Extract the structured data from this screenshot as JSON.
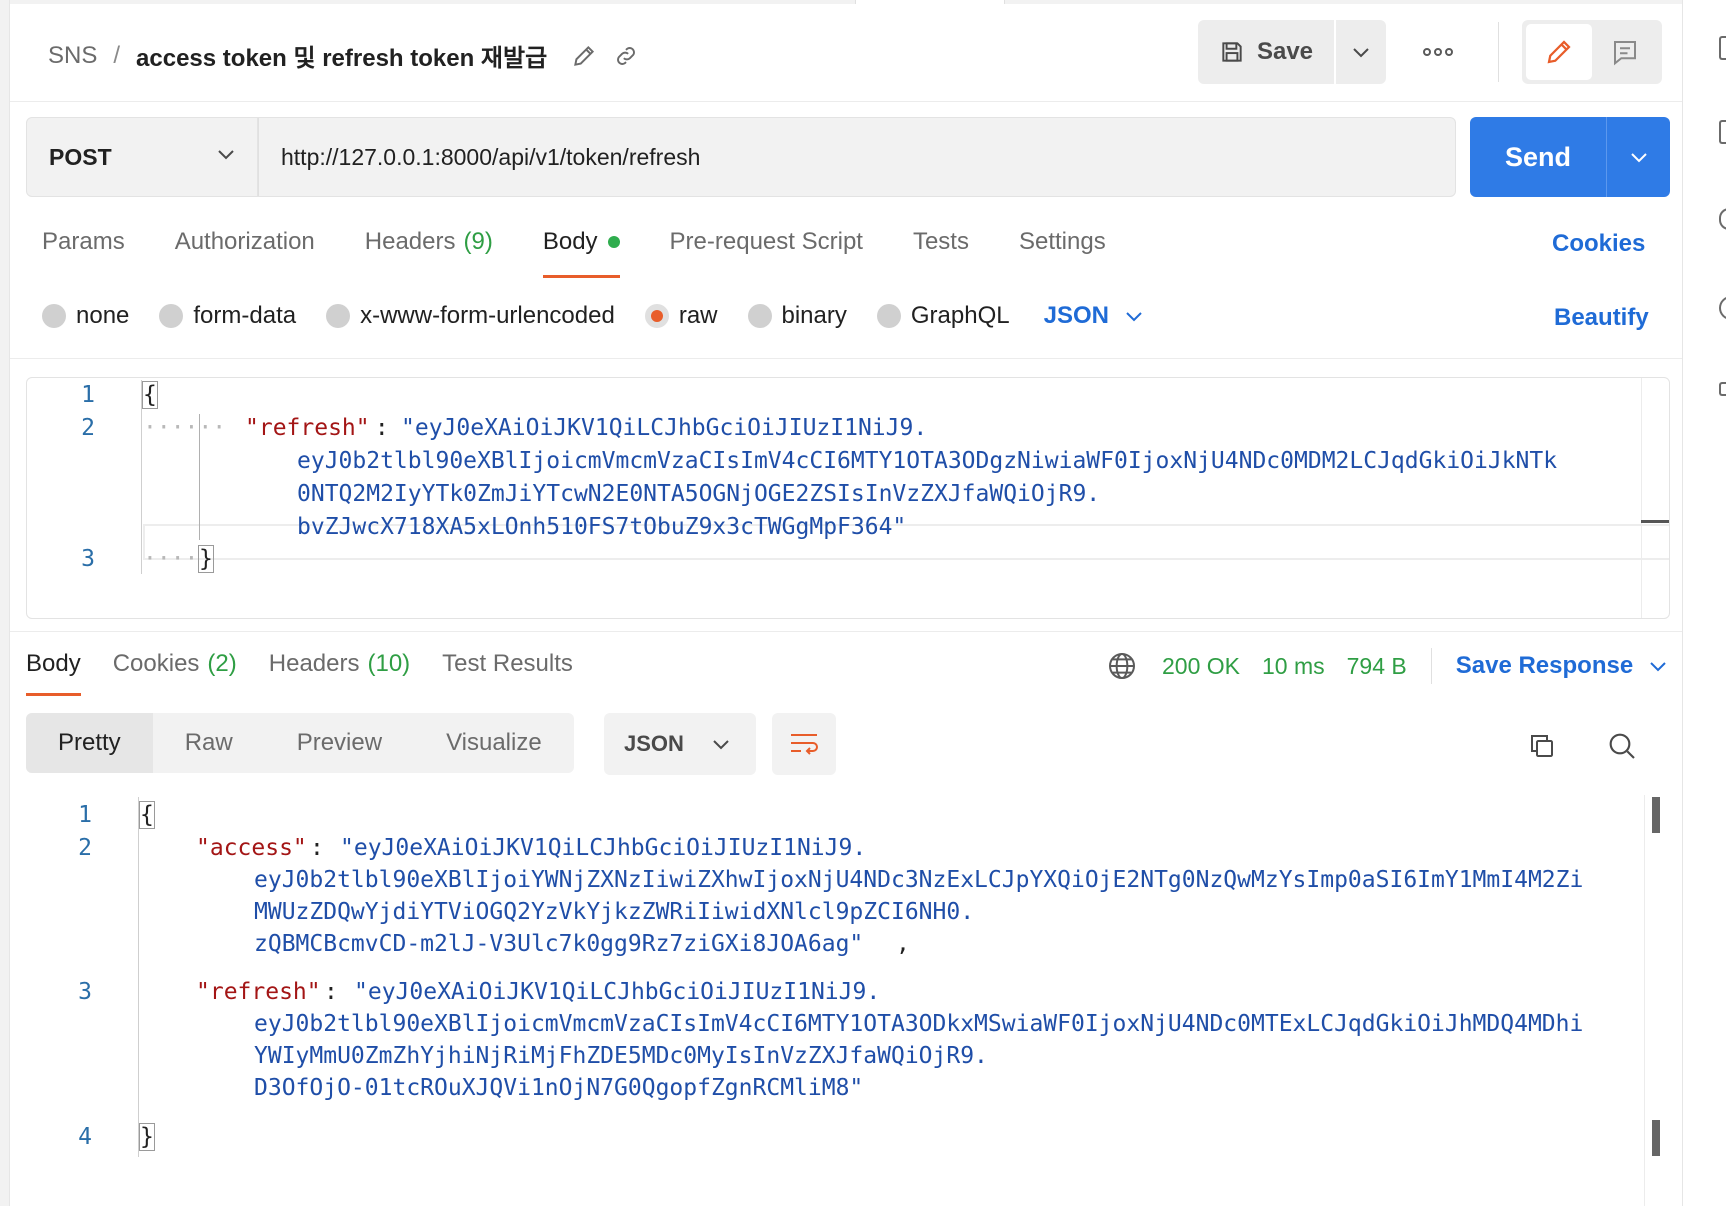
{
  "breadcrumb": {
    "root": "SNS",
    "separator": "/",
    "title": "access token 및 refresh token 재발급"
  },
  "header": {
    "save_label": "Save"
  },
  "request": {
    "method": "POST",
    "url": "http://127.0.0.1:8000/api/v1/token/refresh",
    "send_label": "Send"
  },
  "request_tabs": [
    {
      "label": "Params",
      "count": ""
    },
    {
      "label": "Authorization",
      "count": ""
    },
    {
      "label": "Headers",
      "count": "(9)"
    },
    {
      "label": "Body",
      "count": ""
    },
    {
      "label": "Pre-request Script",
      "count": ""
    },
    {
      "label": "Tests",
      "count": ""
    },
    {
      "label": "Settings",
      "count": ""
    }
  ],
  "cookies_label": "Cookies",
  "body_types": [
    "none",
    "form-data",
    "x-www-form-urlencoded",
    "raw",
    "binary",
    "GraphQL"
  ],
  "body_selected": "raw",
  "body_format": "JSON",
  "beautify_label": "Beautify",
  "request_body": {
    "line_numbers": [
      "1",
      "2",
      "3"
    ],
    "open_brace": "{",
    "close_brace": "}",
    "key": "\"refresh\"",
    "colon": " : ",
    "value_lines": [
      "\"eyJ0eXAiOiJKV1QiLCJhbGciOiJIUzI1NiJ9.",
      "eyJ0b2tlbl90eXBlIjoicmVmcmVzaCIsImV4cCI6MTY1OTA3ODgzNiwiaWF0IjoxNjU4NDc0MDM2LCJqdGkiOiJkNTk",
      "0NTQ2M2IyYTk0ZmJiYTcwN2E0NTA5OGNjOGE2ZSIsInVzZXJfaWQiOjR9.",
      "bvZJwcX718XA5xLOnh510FS7tObuZ9x3cTWGgMpF364\""
    ]
  },
  "response_tabs": [
    {
      "label": "Body",
      "count": ""
    },
    {
      "label": "Cookies",
      "count": "(2)"
    },
    {
      "label": "Headers",
      "count": "(10)"
    },
    {
      "label": "Test Results",
      "count": ""
    }
  ],
  "response_status": {
    "status": "200 OK",
    "time": "10 ms",
    "size": "794 B",
    "save_response_label": "Save Response"
  },
  "response_views": [
    "Pretty",
    "Raw",
    "Preview",
    "Visualize"
  ],
  "response_format": "JSON",
  "response_body": {
    "line_numbers": [
      "1",
      "2",
      "3",
      "4"
    ],
    "open_brace": "{",
    "close_brace": "}",
    "access_key": "\"access\"",
    "access_lines": [
      "\"eyJ0eXAiOiJKV1QiLCJhbGciOiJIUzI1NiJ9.",
      "eyJ0b2tlbl90eXBlIjoiYWNjZXNzIiwiZXhwIjoxNjU4NDc3NzExLCJpYXQiOjE2NTg0NzQwMzYsImp0aSI6ImY1MmI4M2Zi",
      "MWUzZDQwYjdiYTViOGQ2YzVkYjkzZWRiIiwidXNlcl9pZCI6NH0.",
      "zQBMCBcmvCD-m2lJ-V3Ulc7k0gg9Rz7ziGXi8JOA6ag\""
    ],
    "refresh_key": "\"refresh\"",
    "refresh_lines": [
      "\"eyJ0eXAiOiJKV1QiLCJhbGciOiJIUzI1NiJ9.",
      "eyJ0b2tlbl90eXBlIjoicmVmcmVzaCIsImV4cCI6MTY1OTA3ODkxMSwiaWF0IjoxNjU4NDc0MTExLCJqdGkiOiJhMDQ4MDhi",
      "YWIyMmU0ZmZhYjhiNjRiMjFhZDE5MDc0MyIsInVzZXJfaWQiOjR9.",
      "D3OfOjO-01tcROuXJQVi1nOjN7G0QgopfZgnRCMliM8\""
    ]
  },
  "colors": {
    "accent": "#e85d2a",
    "send": "#2f7be6",
    "link": "#1f6bd6",
    "status_ok": "#2f9e44",
    "json_key": "#a31515",
    "json_string": "#1f4ea8"
  }
}
